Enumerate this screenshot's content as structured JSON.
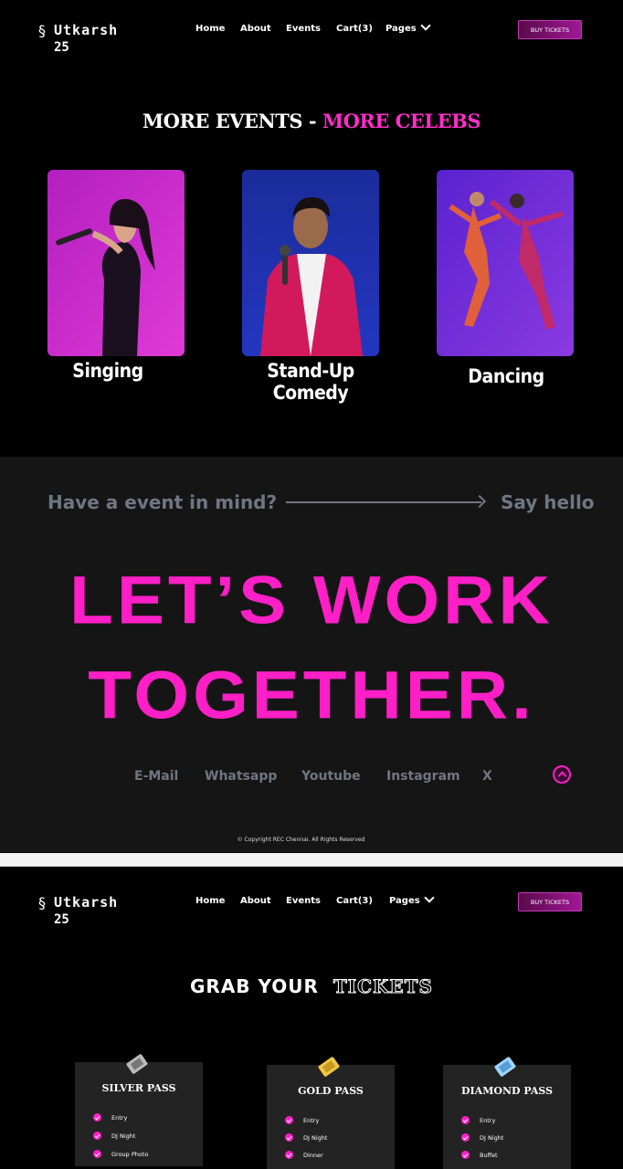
{
  "nav": {
    "logo_word": "Utkarsh",
    "logo_num": "25",
    "links": [
      "Home",
      "About",
      "Events",
      "Cart(3)",
      "Pages"
    ],
    "buy_label": "BUY TICKETS"
  },
  "events": {
    "title_white": "MORE EVENTS - ",
    "title_pink": "MORE CELEBS",
    "cards": [
      {
        "label": "Singing"
      },
      {
        "label": "Stand-Up Comedy"
      },
      {
        "label": "Dancing"
      }
    ]
  },
  "contact": {
    "ask": "Have a event in mind?",
    "say": "Say hello",
    "headline_1": "LET’S WORK",
    "headline_2": "TOGETHER.",
    "social": [
      "E-Mail",
      "Whatsapp",
      "Youtube",
      "Instagram",
      "X"
    ],
    "copyright": "© Copyright REC Chennai. All Rights Reserved"
  },
  "tickets": {
    "title_plain": "GRAB YOUR",
    "title_outline": "TICKETS",
    "passes": [
      {
        "name": "SILVER PASS",
        "features": [
          "Entry",
          "DJ Night",
          "Group Photo"
        ]
      },
      {
        "name": "GOLD PASS",
        "features": [
          "Entry",
          "DJ Night",
          "Dinner"
        ]
      },
      {
        "name": "DIAMOND PASS",
        "features": [
          "Entry",
          "DJ Night",
          "Buffet"
        ]
      }
    ]
  },
  "colors": {
    "accent": "#ff1fc6",
    "contact_bg": "#151515",
    "muted": "#6f7683"
  }
}
